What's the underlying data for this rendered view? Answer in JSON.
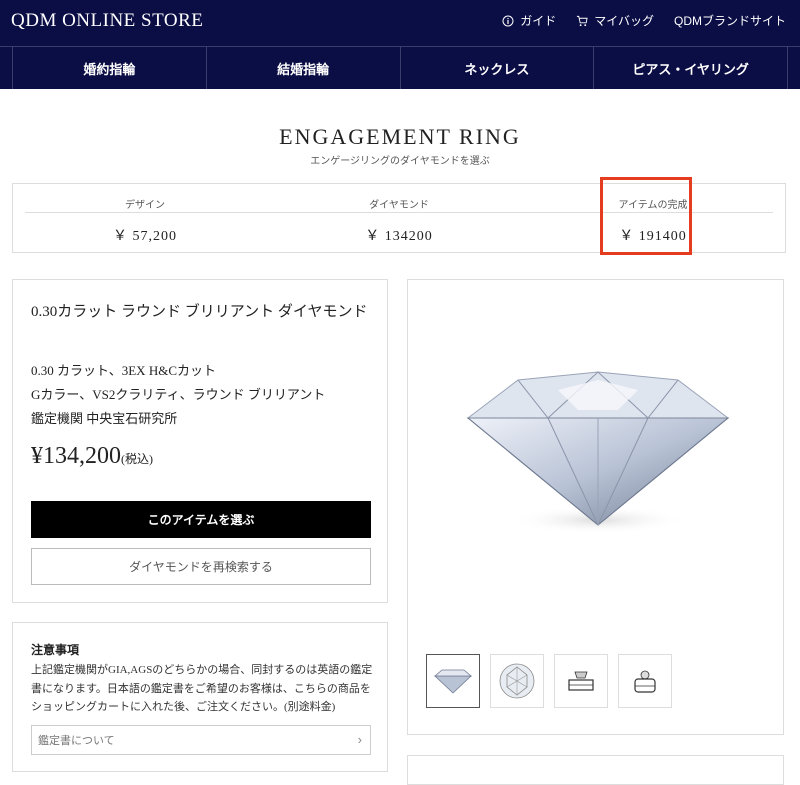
{
  "header": {
    "logo": "QDM ONLINE STORE",
    "links": [
      {
        "label": "ガイド",
        "icon": "info-icon"
      },
      {
        "label": "マイバッグ",
        "icon": "cart-icon"
      },
      {
        "label": "QDMブランドサイト",
        "icon": ""
      }
    ]
  },
  "nav": {
    "tabs": [
      "婚約指輪",
      "結婚指輪",
      "ネックレス",
      "ピアス・イヤリング"
    ]
  },
  "page": {
    "title": "ENGAGEMENT RING",
    "subtitle": "エンゲージリングのダイヤモンドを選ぶ"
  },
  "summary": {
    "design_label": "デザイン",
    "design_value": "￥ 57,200",
    "diamond_label": "ダイヤモンド",
    "diamond_value": "￥ 134200",
    "total_label": "アイテムの完成",
    "total_value": "￥ 191400",
    "highlight_color": "#e53b1f"
  },
  "product": {
    "name": "0.30カラット ラウンド ブリリアント ダイヤモンド",
    "spec1": "0.30 カラット、3EX H&Cカット",
    "spec2": "Gカラー、VS2クラリティ、ラウンド ブリリアント",
    "spec3": "鑑定機関 中央宝石研究所",
    "price": "¥134,200",
    "tax_note": "(税込)",
    "select_button": "このアイテムを選ぶ",
    "research_button": "ダイヤモンドを再検索する"
  },
  "notes": {
    "title": "注意事項",
    "body": "上記鑑定機関がGIA,AGSのどちらかの場合、同封するのは英語の鑑定書になります。日本語の鑑定書をご希望のお客様は、こちらの商品をショッピングカートに入れた後、ご注文ください。(別途料金)",
    "link": "鑑定書について"
  },
  "colors": {
    "header_bg": "#0b0d45",
    "button_bg": "#000000"
  }
}
